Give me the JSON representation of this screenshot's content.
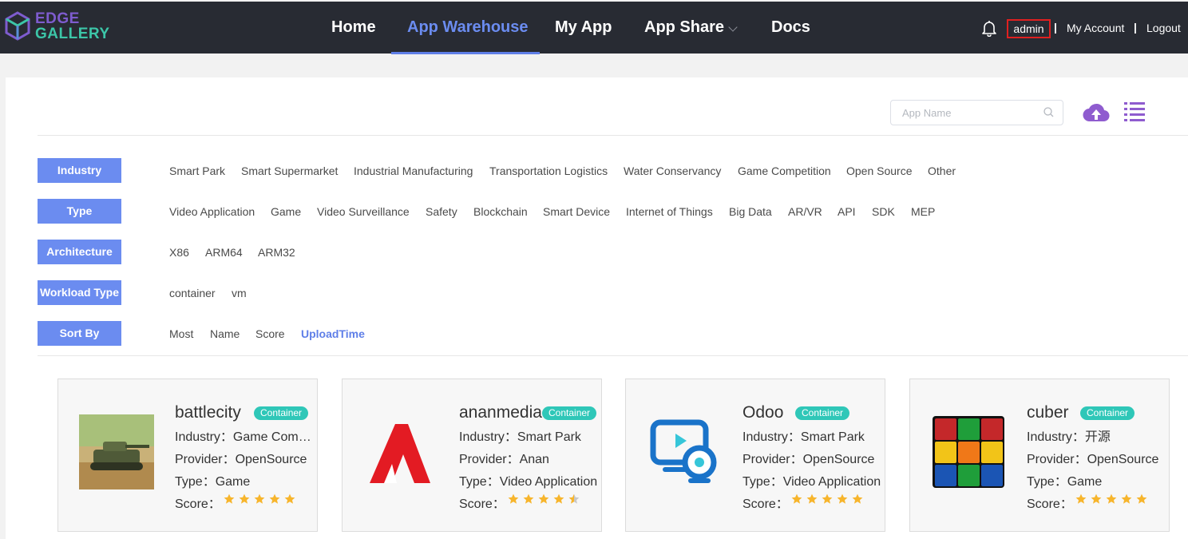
{
  "brand": {
    "line1": "EDGE",
    "line2": "GALLERY"
  },
  "nav": {
    "items": [
      {
        "label": "Home"
      },
      {
        "label": "App Warehouse",
        "active": true
      },
      {
        "label": "My App"
      },
      {
        "label": "App Share"
      },
      {
        "label": "Docs"
      }
    ]
  },
  "user": {
    "name": "admin",
    "my_account": "My Account",
    "logout": "Logout",
    "separator": "|"
  },
  "search": {
    "placeholder": "App Name"
  },
  "filters": {
    "industry": {
      "label": "Industry",
      "options": [
        "Smart Park",
        "Smart Supermarket",
        "Industrial Manufacturing",
        "Transportation Logistics",
        "Water Conservancy",
        "Game Competition",
        "Open Source",
        "Other"
      ]
    },
    "type": {
      "label": "Type",
      "options": [
        "Video Application",
        "Game",
        "Video Surveillance",
        "Safety",
        "Blockchain",
        "Smart Device",
        "Internet of Things",
        "Big Data",
        "AR/VR",
        "API",
        "SDK",
        "MEP"
      ]
    },
    "architecture": {
      "label": "Architecture",
      "options": [
        "X86",
        "ARM64",
        "ARM32"
      ]
    },
    "workload": {
      "label": "Workload Type",
      "options": [
        "container",
        "vm"
      ]
    },
    "sort": {
      "label": "Sort By",
      "options": [
        "Most",
        "Name",
        "Score",
        "UploadTime"
      ],
      "active": "UploadTime"
    }
  },
  "apps": [
    {
      "name": "battlecity",
      "badge": "Container",
      "industry": "Industry：Game Competition",
      "provider": "Provider：OpenSource",
      "type": "Type：Game",
      "score_label": "Score：",
      "score": 5,
      "icon": "tank-game-icon"
    },
    {
      "name": "ananmedia",
      "badge": "Container",
      "industry": "Industry：Smart Park",
      "provider": "Provider：Anan",
      "type": "Type：Video Application",
      "score_label": "Score：",
      "score": 4.5,
      "icon": "anan-logo-icon"
    },
    {
      "name": "Odoo",
      "badge": "Container",
      "industry": "Industry：Smart Park",
      "provider": "Provider：OpenSource",
      "type": "Type：Video Application",
      "score_label": "Score：",
      "score": 5,
      "icon": "video-camera-monitor-icon"
    },
    {
      "name": "cuber",
      "badge": "Container",
      "industry": "Industry：开源",
      "provider": "Provider：OpenSource",
      "type": "Type：Game",
      "score_label": "Score：",
      "score": 5,
      "icon": "rubiks-cube-icon"
    }
  ],
  "colors": {
    "accent": "#6b8cf0",
    "badge": "#2fc7b8",
    "star": "#f7b52c",
    "topbar": "#282b33"
  }
}
